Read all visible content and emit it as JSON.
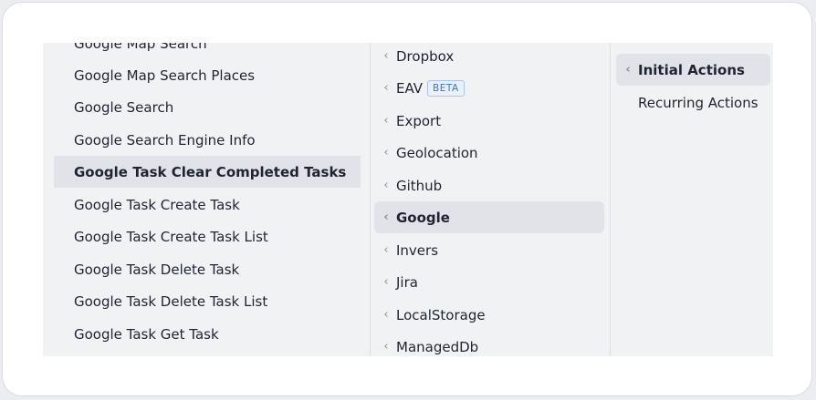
{
  "column1": {
    "partial_top": "Google Map Search",
    "items": [
      "Google Map Search Places",
      "Google Search",
      "Google Search Engine Info",
      "Google Task Clear Completed Tasks",
      "Google Task Create Task",
      "Google Task Create Task List",
      "Google Task Delete Task",
      "Google Task Delete Task List",
      "Google Task Get Task"
    ],
    "active_index": 3
  },
  "column2": {
    "items": [
      {
        "label": "Dropbox"
      },
      {
        "label": "EAV",
        "badge": "BETA"
      },
      {
        "label": "Export"
      },
      {
        "label": "Geolocation"
      },
      {
        "label": "Github"
      },
      {
        "label": "Google"
      },
      {
        "label": "Invers"
      },
      {
        "label": "Jira"
      },
      {
        "label": "LocalStorage"
      },
      {
        "label": "ManagedDb"
      }
    ],
    "active_index": 5
  },
  "column3": {
    "items": [
      {
        "label": "Initial Actions",
        "has_chevron": true
      },
      {
        "label": "Recurring Actions",
        "has_chevron": false
      }
    ],
    "active_index": 0
  },
  "icons": {
    "chevron": "chevron-left-icon"
  }
}
